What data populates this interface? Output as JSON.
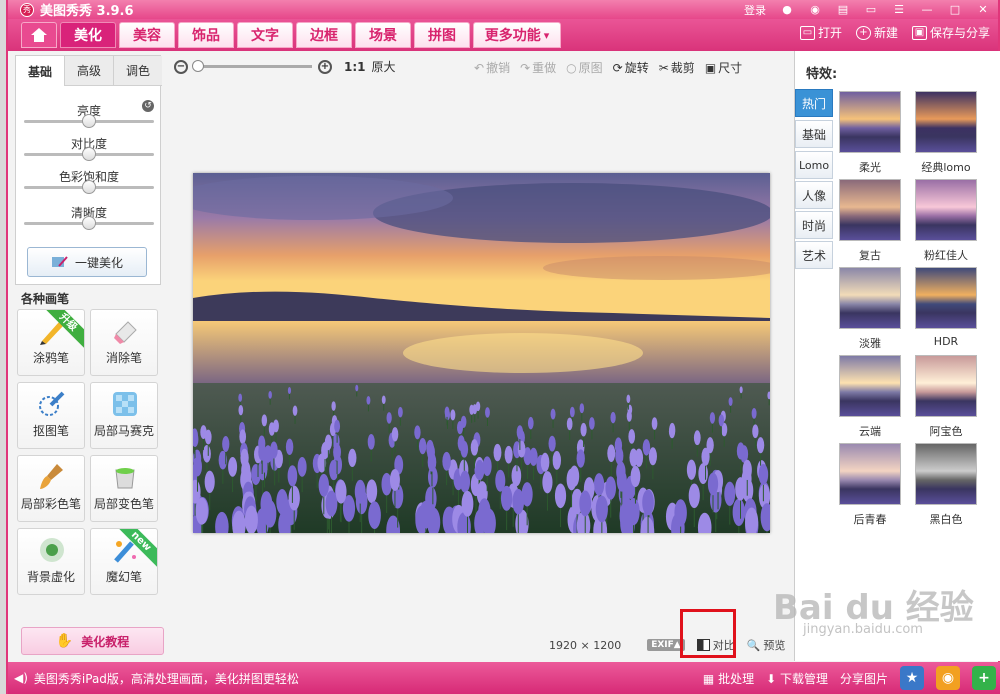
{
  "app": {
    "title": "美图秀秀 3.9.6",
    "logo_char": "秀"
  },
  "titlebar": {
    "login": "登录"
  },
  "menu": {
    "tabs": [
      "美化",
      "美容",
      "饰品",
      "文字",
      "边框",
      "场景",
      "拼图",
      "更多功能"
    ],
    "more_arrow": "▾"
  },
  "top_actions": {
    "open": "打开",
    "new": "新建",
    "save_share": "保存与分享"
  },
  "left": {
    "subtabs": [
      "基础",
      "高级",
      "调色"
    ],
    "sliders": [
      {
        "label": "亮度",
        "value": 0.5
      },
      {
        "label": "对比度",
        "value": 0.5
      },
      {
        "label": "色彩饱和度",
        "value": 0.5
      },
      {
        "label": "清晰度",
        "value": 0.5
      }
    ],
    "one_click": "一键美化",
    "brush_section": "各种画笔",
    "brushes": [
      {
        "label": "涂鸦笔",
        "badge": "升级"
      },
      {
        "label": "消除笔",
        "badge": ""
      },
      {
        "label": "抠图笔",
        "badge": ""
      },
      {
        "label": "局部马赛克",
        "badge": ""
      },
      {
        "label": "局部彩色笔",
        "badge": ""
      },
      {
        "label": "局部变色笔",
        "badge": ""
      },
      {
        "label": "背景虚化",
        "badge": ""
      },
      {
        "label": "魔幻笔",
        "badge": "new"
      }
    ],
    "tutorial": "美化教程"
  },
  "canvas": {
    "zoom_ratio": "1:1",
    "zoom_original": "原大",
    "zoom_level": 0.0,
    "tools": {
      "undo": "撤销",
      "redo": "重做",
      "original": "原图",
      "rotate": "旋转",
      "crop": "裁剪",
      "size": "尺寸"
    },
    "dimensions": "1920 × 1200",
    "exif": "EXIF▲",
    "compare": "对比",
    "preview": "预览"
  },
  "right": {
    "heading": "特效:",
    "categories": [
      "热门",
      "基础",
      "Lomo",
      "人像",
      "时尚",
      "艺术"
    ],
    "effects": [
      {
        "label": "柔光"
      },
      {
        "label": "经典lomo"
      },
      {
        "label": "复古"
      },
      {
        "label": "粉红佳人"
      },
      {
        "label": "淡雅"
      },
      {
        "label": "HDR"
      },
      {
        "label": "云端"
      },
      {
        "label": "阿宝色"
      },
      {
        "label": "后青春"
      },
      {
        "label": "黑白色"
      }
    ]
  },
  "status": {
    "message": "美图秀秀iPad版，高清处理画面，美化拼图更轻松",
    "batch": "批处理",
    "download": "下载管理",
    "share": "分享图片"
  },
  "watermark": {
    "main": "Bai du 经验",
    "sub": "jingyan.baidu.com"
  }
}
